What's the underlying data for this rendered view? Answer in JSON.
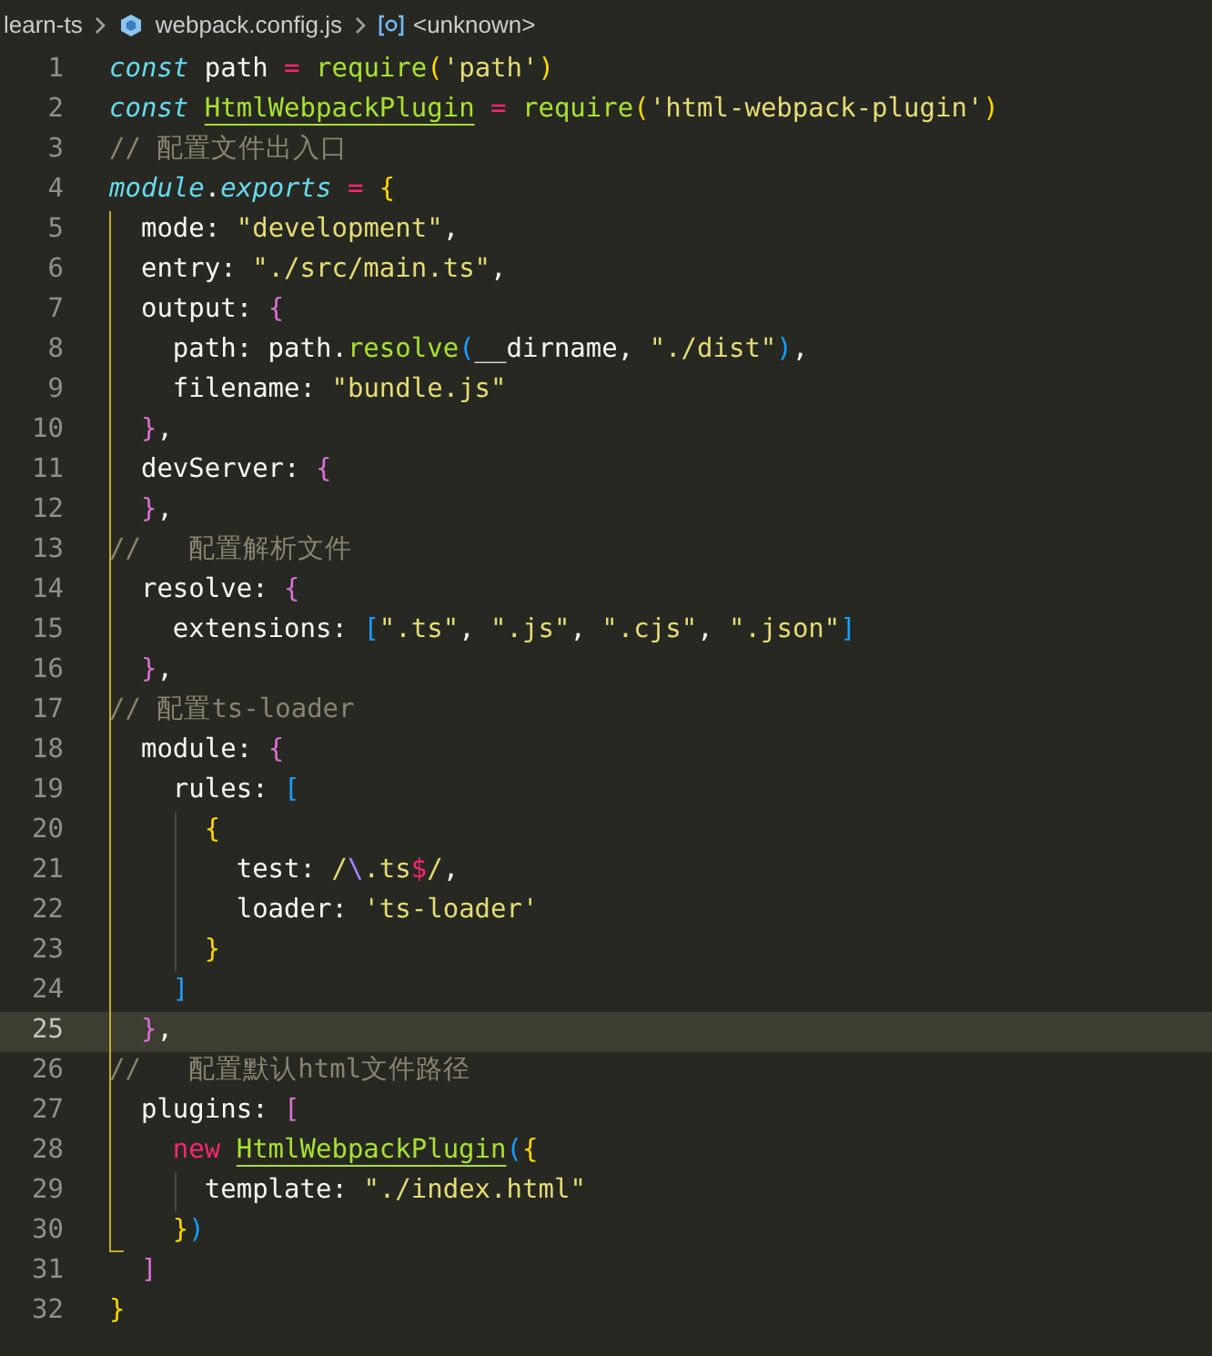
{
  "breadcrumb": {
    "folder": "learn-ts",
    "file": "webpack.config.js",
    "symbol": "<unknown>"
  },
  "lines": [
    {
      "number": "1",
      "current": false,
      "tokens": [
        {
          "text": "const",
          "kind": "kw"
        },
        {
          "text": " path ",
          "kind": "plain"
        },
        {
          "text": "=",
          "kind": "op"
        },
        {
          "text": " require",
          "kind": "fn"
        },
        {
          "text": "(",
          "kind": "b1"
        },
        {
          "text": "'path'",
          "kind": "str"
        },
        {
          "text": ")",
          "kind": "b1"
        }
      ]
    },
    {
      "number": "2",
      "current": false,
      "tokens": [
        {
          "text": "const ",
          "kind": "kw"
        },
        {
          "text": "HtmlWebpackPlugin",
          "kind": "class"
        },
        {
          "text": " =",
          "kind": "op"
        },
        {
          "text": " require",
          "kind": "fn"
        },
        {
          "text": "(",
          "kind": "b1"
        },
        {
          "text": "'html-webpack-plugin'",
          "kind": "str"
        },
        {
          "text": ")",
          "kind": "b1"
        }
      ]
    },
    {
      "number": "3",
      "current": false,
      "tokens": [
        {
          "text": "// 配置文件出入口",
          "kind": "comment"
        }
      ]
    },
    {
      "number": "4",
      "current": false,
      "tokens": [
        {
          "text": "module",
          "kind": "kw"
        },
        {
          "text": ".",
          "kind": "plain"
        },
        {
          "text": "exports",
          "kind": "kw"
        },
        {
          "text": " =",
          "kind": "op"
        },
        {
          "text": " {",
          "kind": "b1"
        }
      ]
    },
    {
      "number": "5",
      "current": false,
      "tokens": [
        {
          "text": "  mode: ",
          "kind": "plain"
        },
        {
          "text": "\"development\"",
          "kind": "str"
        },
        {
          "text": ",",
          "kind": "plain"
        }
      ]
    },
    {
      "number": "6",
      "current": false,
      "tokens": [
        {
          "text": "  entry: ",
          "kind": "plain"
        },
        {
          "text": "\"./src/main.ts\"",
          "kind": "str"
        },
        {
          "text": ",",
          "kind": "plain"
        }
      ]
    },
    {
      "number": "7",
      "current": false,
      "tokens": [
        {
          "text": "  output: ",
          "kind": "plain"
        },
        {
          "text": "{",
          "kind": "b2"
        }
      ]
    },
    {
      "number": "8",
      "current": false,
      "tokens": [
        {
          "text": "    path: path.",
          "kind": "plain"
        },
        {
          "text": "resolve",
          "kind": "fn"
        },
        {
          "text": "(",
          "kind": "b3"
        },
        {
          "text": "__dirname, ",
          "kind": "plain"
        },
        {
          "text": "\"./dist\"",
          "kind": "str"
        },
        {
          "text": ")",
          "kind": "b3"
        },
        {
          "text": ",",
          "kind": "plain"
        }
      ]
    },
    {
      "number": "9",
      "current": false,
      "tokens": [
        {
          "text": "    filename: ",
          "kind": "plain"
        },
        {
          "text": "\"bundle.js\"",
          "kind": "str"
        }
      ]
    },
    {
      "number": "10",
      "current": false,
      "tokens": [
        {
          "text": "  }",
          "kind": "b2"
        },
        {
          "text": ",",
          "kind": "plain"
        }
      ]
    },
    {
      "number": "11",
      "current": false,
      "tokens": [
        {
          "text": "  devServer: ",
          "kind": "plain"
        },
        {
          "text": "{",
          "kind": "b2"
        }
      ]
    },
    {
      "number": "12",
      "current": false,
      "tokens": [
        {
          "text": "  }",
          "kind": "b2"
        },
        {
          "text": ",",
          "kind": "plain"
        }
      ]
    },
    {
      "number": "13",
      "current": false,
      "tokens": [
        {
          "text": "//   配置解析文件",
          "kind": "comment"
        }
      ]
    },
    {
      "number": "14",
      "current": false,
      "tokens": [
        {
          "text": "  resolve: ",
          "kind": "plain"
        },
        {
          "text": "{",
          "kind": "b2"
        }
      ]
    },
    {
      "number": "15",
      "current": false,
      "tokens": [
        {
          "text": "    extensions: ",
          "kind": "plain"
        },
        {
          "text": "[",
          "kind": "b3"
        },
        {
          "text": "\".ts\"",
          "kind": "str"
        },
        {
          "text": ", ",
          "kind": "plain"
        },
        {
          "text": "\".js\"",
          "kind": "str"
        },
        {
          "text": ", ",
          "kind": "plain"
        },
        {
          "text": "\".cjs\"",
          "kind": "str"
        },
        {
          "text": ", ",
          "kind": "plain"
        },
        {
          "text": "\".json\"",
          "kind": "str"
        },
        {
          "text": "]",
          "kind": "b3"
        }
      ]
    },
    {
      "number": "16",
      "current": false,
      "tokens": [
        {
          "text": "  }",
          "kind": "b2"
        },
        {
          "text": ",",
          "kind": "plain"
        }
      ]
    },
    {
      "number": "17",
      "current": false,
      "tokens": [
        {
          "text": "// 配置ts-loader",
          "kind": "comment"
        }
      ]
    },
    {
      "number": "18",
      "current": false,
      "tokens": [
        {
          "text": "  module: ",
          "kind": "plain"
        },
        {
          "text": "{",
          "kind": "b2"
        }
      ]
    },
    {
      "number": "19",
      "current": false,
      "tokens": [
        {
          "text": "    rules: ",
          "kind": "plain"
        },
        {
          "text": "[",
          "kind": "b3"
        }
      ]
    },
    {
      "number": "20",
      "current": false,
      "tokens": [
        {
          "text": "      {",
          "kind": "b1"
        }
      ]
    },
    {
      "number": "21",
      "current": false,
      "tokens": [
        {
          "text": "        test: ",
          "kind": "plain"
        },
        {
          "text": "/",
          "kind": "str"
        },
        {
          "text": "\\",
          "kind": "esc"
        },
        {
          "text": ".ts",
          "kind": "str"
        },
        {
          "text": "$",
          "kind": "op"
        },
        {
          "text": "/",
          "kind": "str"
        },
        {
          "text": ",",
          "kind": "plain"
        }
      ]
    },
    {
      "number": "22",
      "current": false,
      "tokens": [
        {
          "text": "        loader: ",
          "kind": "plain"
        },
        {
          "text": "'ts-loader'",
          "kind": "str"
        }
      ]
    },
    {
      "number": "23",
      "current": false,
      "tokens": [
        {
          "text": "      }",
          "kind": "b1"
        }
      ]
    },
    {
      "number": "24",
      "current": false,
      "tokens": [
        {
          "text": "    ]",
          "kind": "b3"
        }
      ]
    },
    {
      "number": "25",
      "current": true,
      "tokens": [
        {
          "text": "  }",
          "kind": "b2"
        },
        {
          "text": ",",
          "kind": "plain"
        }
      ]
    },
    {
      "number": "26",
      "current": false,
      "tokens": [
        {
          "text": "//   配置默认html文件路径",
          "kind": "comment"
        }
      ]
    },
    {
      "number": "27",
      "current": false,
      "tokens": [
        {
          "text": "  plugins: ",
          "kind": "plain"
        },
        {
          "text": "[",
          "kind": "b2"
        }
      ]
    },
    {
      "number": "28",
      "current": false,
      "tokens": [
        {
          "text": "    new ",
          "kind": "op"
        },
        {
          "text": "HtmlWebpackPlugin",
          "kind": "class"
        },
        {
          "text": "(",
          "kind": "b3"
        },
        {
          "text": "{",
          "kind": "b1"
        }
      ]
    },
    {
      "number": "29",
      "current": false,
      "tokens": [
        {
          "text": "      template: ",
          "kind": "plain"
        },
        {
          "text": "\"./index.html\"",
          "kind": "str"
        }
      ]
    },
    {
      "number": "30",
      "current": false,
      "tokens": [
        {
          "text": "    }",
          "kind": "b1"
        },
        {
          "text": ")",
          "kind": "b3"
        }
      ]
    },
    {
      "number": "31",
      "current": false,
      "tokens": [
        {
          "text": "  ]",
          "kind": "b2"
        }
      ]
    },
    {
      "number": "32",
      "current": false,
      "tokens": [
        {
          "text": "}",
          "kind": "b1"
        }
      ]
    }
  ]
}
